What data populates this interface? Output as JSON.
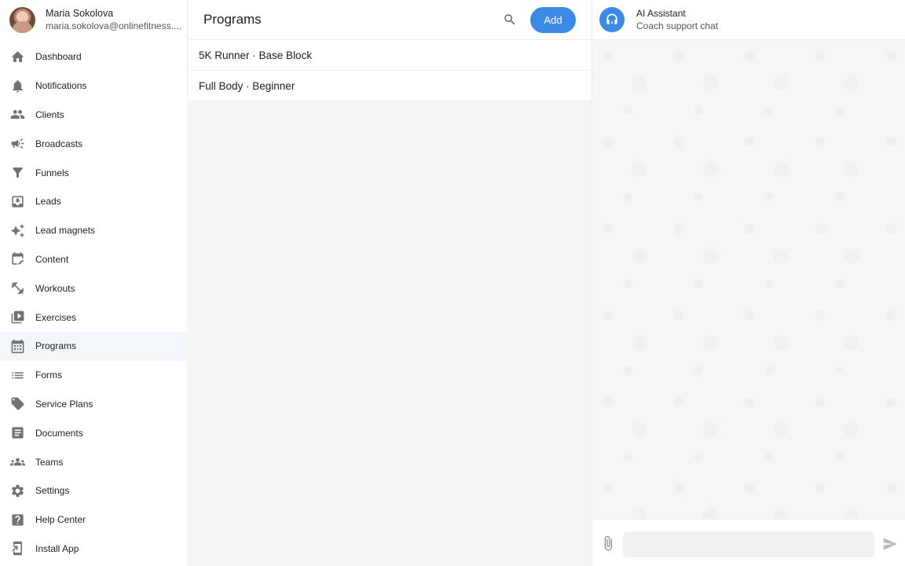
{
  "profile": {
    "name": "Maria Sokolova",
    "email": "maria.sokolova@onlinefitness...."
  },
  "sidebar": {
    "items": [
      {
        "label": "Dashboard",
        "icon": "home-icon"
      },
      {
        "label": "Notifications",
        "icon": "bell-icon"
      },
      {
        "label": "Clients",
        "icon": "people-icon"
      },
      {
        "label": "Broadcasts",
        "icon": "megaphone-icon"
      },
      {
        "label": "Funnels",
        "icon": "funnel-icon"
      },
      {
        "label": "Leads",
        "icon": "inbox-download-icon"
      },
      {
        "label": "Lead magnets",
        "icon": "sparkles-icon"
      },
      {
        "label": "Content",
        "icon": "calendar-edit-icon"
      },
      {
        "label": "Workouts",
        "icon": "dumbbell-icon"
      },
      {
        "label": "Exercises",
        "icon": "video-library-icon"
      },
      {
        "label": "Programs",
        "icon": "calendar-grid-icon"
      },
      {
        "label": "Forms",
        "icon": "list-icon"
      },
      {
        "label": "Service Plans",
        "icon": "tag-icon"
      },
      {
        "label": "Documents",
        "icon": "document-icon"
      },
      {
        "label": "Teams",
        "icon": "groups-icon"
      },
      {
        "label": "Settings",
        "icon": "gear-icon"
      },
      {
        "label": "Help Center",
        "icon": "help-icon"
      },
      {
        "label": "Install App",
        "icon": "install-icon"
      }
    ],
    "active": "Programs"
  },
  "programs": {
    "title": "Programs",
    "add_label": "Add",
    "items": [
      {
        "name": "5K Runner · Base Block"
      },
      {
        "name": "Full Body · Beginner"
      }
    ]
  },
  "chat": {
    "title": "AI Assistant",
    "subtitle": "Coach support chat",
    "input_value": "",
    "input_placeholder": ""
  },
  "colors": {
    "accent": "#3d8ae6",
    "active_nav_bg": "#f3f6fa",
    "panel_bg": "#f4f4f4"
  }
}
